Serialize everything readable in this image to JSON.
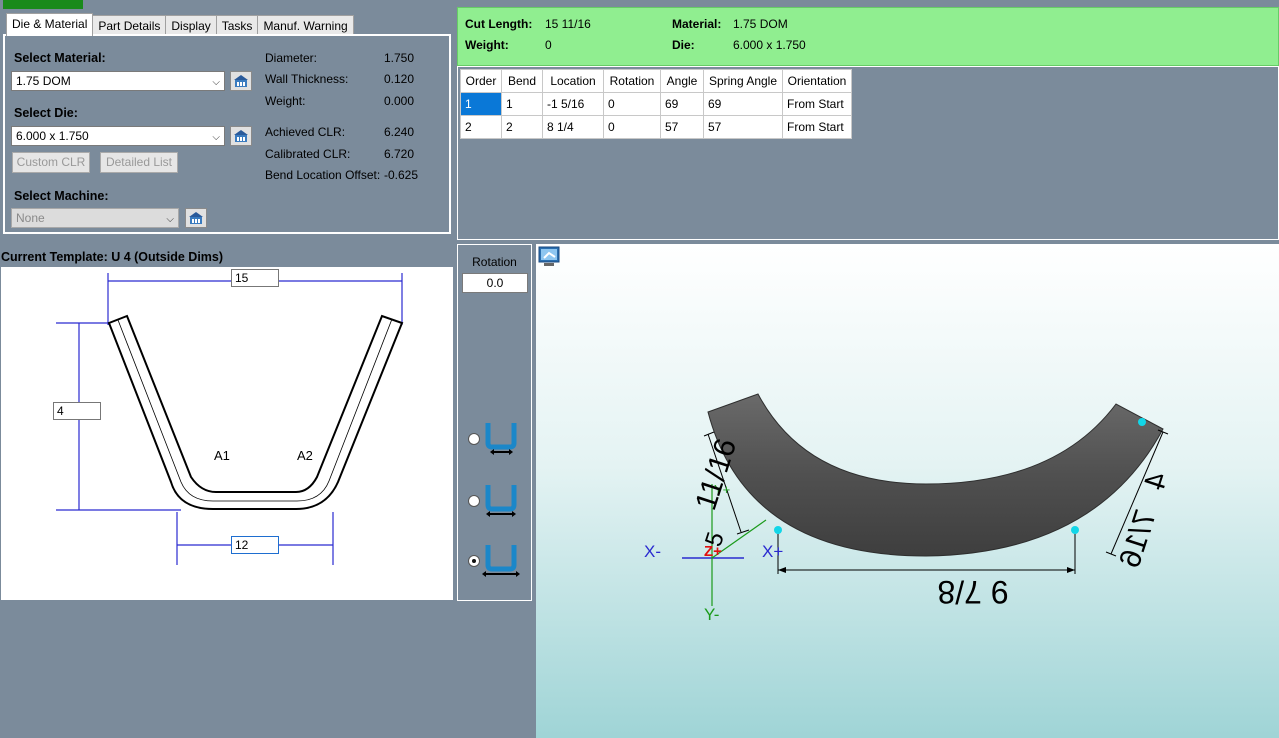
{
  "tabs": [
    "Die & Material",
    "Part Details",
    "Display",
    "Tasks",
    "Manuf. Warning"
  ],
  "active_tab": 0,
  "die_material": {
    "select_material_label": "Select Material:",
    "material_value": "1.75 DOM",
    "select_die_label": "Select Die:",
    "die_value": "6.000 x 1.750",
    "custom_clr_label": "Custom CLR",
    "detailed_list_label": "Detailed List",
    "select_machine_label": "Select Machine:",
    "machine_value": "None",
    "props": [
      {
        "label": "Diameter:",
        "value": "1.750"
      },
      {
        "label": "Wall Thickness:",
        "value": "0.120"
      },
      {
        "label": "Weight:",
        "value": "0.000"
      },
      {
        "label": "Achieved CLR:",
        "value": "6.240"
      },
      {
        "label": "Calibrated CLR:",
        "value": "6.720"
      },
      {
        "label": "Bend Location Offset:",
        "value": "-0.625"
      }
    ]
  },
  "summary": {
    "cut_length_label": "Cut Length:",
    "cut_length_value": "15 11/16",
    "weight_label": "Weight:",
    "weight_value": "0",
    "material_label": "Material:",
    "material_value": "1.75 DOM",
    "die_label": "Die:",
    "die_value": "6.000 x 1.750"
  },
  "bend_table": {
    "headers": [
      "Order",
      "Bend",
      "Location",
      "Rotation",
      "Angle",
      "Spring Angle",
      "Orientation"
    ],
    "rows": [
      [
        "1",
        "1",
        "-1 5/16",
        "0",
        "69",
        "69",
        "From Start"
      ],
      [
        "2",
        "2",
        "8 1/4",
        "0",
        "57",
        "57",
        "From Start"
      ]
    ]
  },
  "template": {
    "title": "Current Template: U 4 (Outside Dims)",
    "top_dim": "15",
    "side_dim": "4",
    "bottom_dim": "12",
    "angle1": "A1",
    "angle2": "A2"
  },
  "rotation": {
    "label": "Rotation",
    "value": "0.0"
  },
  "view3d": {
    "dim_left": "11/16",
    "dim_left_suffix": "5",
    "dim_right_a": "4",
    "dim_right_b": "7/16",
    "dim_bottom": "9  7/8",
    "axis_xneg": "X-",
    "axis_xpos": "X+",
    "axis_yneg": "Y-",
    "axis_yplus": "Y+",
    "axis_z": "Z+"
  },
  "colors": {
    "summary_bg": "#90ee90",
    "panel_bg": "#7b8b9b",
    "selection": "#0a78d7",
    "dim_line": "#2a2ad0"
  }
}
